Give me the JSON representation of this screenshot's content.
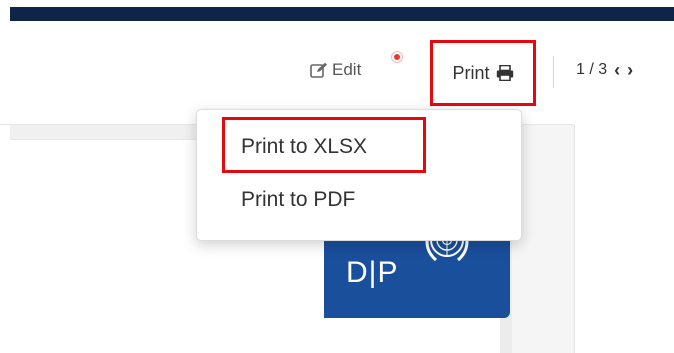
{
  "toolbar": {
    "edit_label": "Edit",
    "print_label": "Print",
    "pager_text": "1 / 3"
  },
  "print_menu": {
    "items": [
      {
        "label": "Print to XLSX"
      },
      {
        "label": "Print to PDF"
      }
    ]
  },
  "logo": {
    "text": "D|P"
  },
  "colors": {
    "header_navy": "#0d2547",
    "highlight_red": "#e5090f",
    "notification_red": "#e53935",
    "logo_blue": "#1a4f9c"
  },
  "icons": [
    "edit-icon",
    "printer-icon",
    "chevron-left-icon",
    "chevron-right-icon",
    "un-emblem-icon"
  ]
}
